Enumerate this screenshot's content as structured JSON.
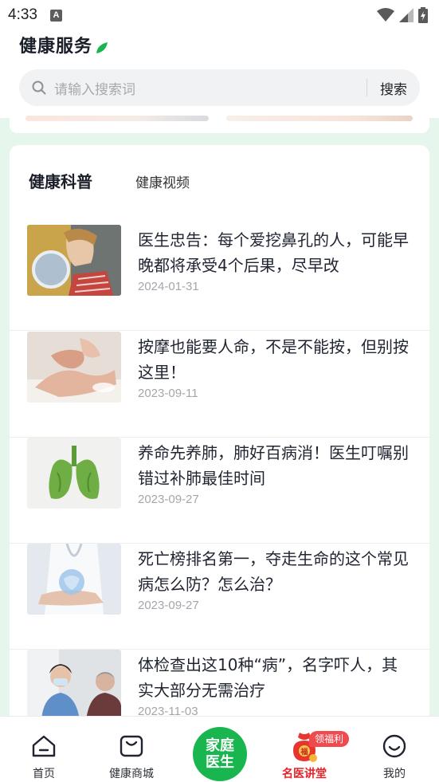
{
  "status_bar": {
    "time": "4:33",
    "notification_icon_letter": "A"
  },
  "header": {
    "title": "健康服务"
  },
  "search": {
    "placeholder": "请输入搜索词",
    "button_label": "搜索"
  },
  "tabs": [
    {
      "label": "健康科普",
      "active": true
    },
    {
      "label": "健康视频",
      "active": false
    }
  ],
  "articles": [
    {
      "title": "医生忠告：每个爱挖鼻孔的人，可能早晚都将承受4个后果，尽早改",
      "date": "2024-01-31"
    },
    {
      "title": "按摩也能要人命，不是不能按，但别按这里！",
      "date": "2023-09-11"
    },
    {
      "title": "养命先养肺，肺好百病消！医生叮嘱别错过补肺最佳时间",
      "date": "2023-09-27"
    },
    {
      "title": "死亡榜排名第一，夺走生命的这个常见病怎么防？怎么治？",
      "date": "2023-09-27"
    },
    {
      "title": "体检查出这10种“病”，名字吓人，其实大部分无需治疗",
      "date": "2023-11-03"
    }
  ],
  "bottom_nav": {
    "home": "首页",
    "mall": "健康商城",
    "family_doctor": "家庭医生",
    "lecture": "名医讲堂",
    "lecture_badge": "领福利",
    "mine": "我的"
  },
  "colors": {
    "accent_green": "#19b54e",
    "badge_red": "#f04a4f",
    "lecture_red": "#e3242b",
    "mint_background": "#e6f6ec"
  }
}
